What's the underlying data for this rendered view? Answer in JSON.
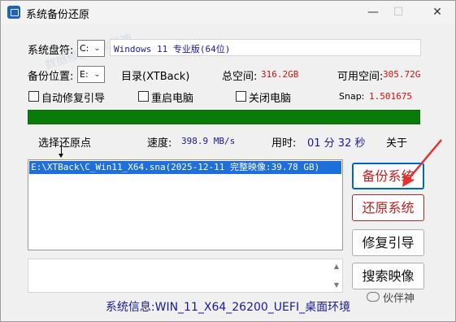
{
  "window": {
    "title": "系统备份还原",
    "min": "—",
    "max": "☐",
    "close": "✕"
  },
  "watermark_overlay": "数据修复 · 伙伴神",
  "row1": {
    "disk_label": "系统盘符:",
    "disk_value": "C:",
    "system_text": "Windows 11 专业版(64位)"
  },
  "row2": {
    "backup_label": "备份位置:",
    "backup_value": "E:",
    "dir_label": "目录(XTBack)",
    "total_label": "总空间:",
    "total_value": "316.2GB",
    "avail_label": "可用空间:",
    "avail_value": "305.72G"
  },
  "row3": {
    "auto_repair": "自动修复引导",
    "restart": "重启电脑",
    "shutdown": "关闭电脑",
    "snap_label": "Snap:",
    "snap_value": "1.501675"
  },
  "progress": {
    "fraction": 1.0
  },
  "row4": {
    "select_label": "选择还原点",
    "speed_label": "速度:",
    "speed_value": "398.9 MB/s",
    "time_label": "用时:",
    "time_value": "01 分 32 秒",
    "about": "关于"
  },
  "restore_points": [
    "E:\\XTBack\\C_Win11_X64.sna(2025-12-11 完整映像:39.78 GB)"
  ],
  "buttons": {
    "backup": "备份系统",
    "restore": "还原系统",
    "repair": "修复引导",
    "search": "搜索映像"
  },
  "status_bar": "系统信息:WIN_11_X64_26200_UEFI_桌面环境",
  "brand_watermark": "伙伴神",
  "colors": {
    "progress": "#0a7a0a",
    "selection": "#1e6fd9",
    "annotation_arrow": "#e53030",
    "value_red": "#d11010",
    "value_blue": "#1a1a99"
  }
}
